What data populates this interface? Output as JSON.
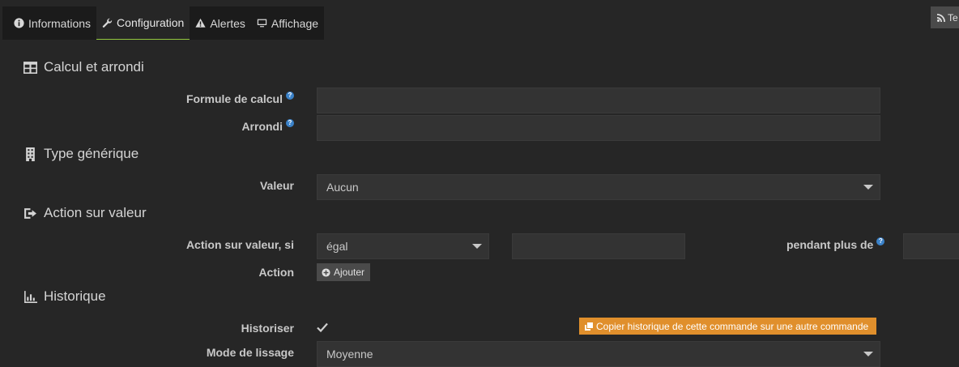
{
  "tabs": {
    "info": "Informations",
    "config": "Configuration",
    "alerts": "Alertes",
    "display": "Affichage"
  },
  "test_button": "Te",
  "calcul": {
    "title": "Calcul et arrondi",
    "formule_label": "Formule de calcul",
    "formule_value": "",
    "arrondi_label": "Arrondi",
    "arrondi_value": ""
  },
  "generic": {
    "title": "Type générique",
    "valeur_label": "Valeur",
    "valeur_selected": "Aucun"
  },
  "action": {
    "title": "Action sur valeur",
    "condition_label": "Action sur valeur, si",
    "operator_selected": "égal",
    "compare_value": "",
    "duration_label": "pendant plus de",
    "duration_value": "",
    "action_label": "Action",
    "add_button": "Ajouter"
  },
  "historique": {
    "title": "Historique",
    "historiser_label": "Historiser",
    "historiser_checked": true,
    "copy_button": "Copier historique de cette commande sur une autre commande",
    "lissage_label": "Mode de lissage",
    "lissage_selected": "Moyenne"
  },
  "colors": {
    "accent_active_tab": "#93c83e",
    "copy_button": "#e08f2c",
    "help_icon": "#3b82c9"
  }
}
